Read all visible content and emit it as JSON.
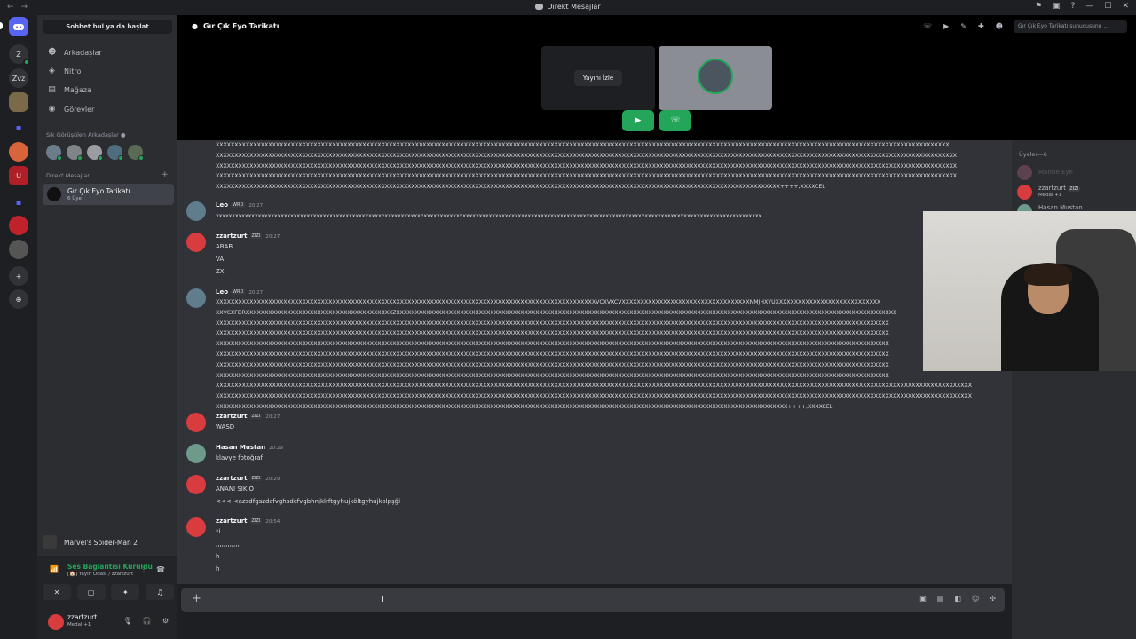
{
  "window": {
    "title": "Direkt Mesajlar",
    "nav_back": "←",
    "nav_forward": "→",
    "right_icons": [
      "⚑",
      "▣",
      "?",
      "—",
      "☐",
      "✕"
    ]
  },
  "guilds": {
    "items": [
      {
        "label": "",
        "icon": "discord-home-icon"
      },
      {
        "label": "Z"
      },
      {
        "label": "Zvz"
      },
      {
        "label": ""
      },
      {
        "label": "▪"
      },
      {
        "label": ""
      },
      {
        "label": "U"
      },
      {
        "label": "▪"
      },
      {
        "label": ""
      },
      {
        "label": ""
      },
      {
        "label": "+"
      },
      {
        "label": "⊕"
      }
    ]
  },
  "sidebar": {
    "find_label": "Sohbet bul ya da başlat",
    "nav": [
      {
        "label": "Arkadaşlar",
        "icon": "friends-icon"
      },
      {
        "label": "Nitro",
        "icon": "nitro-icon"
      },
      {
        "label": "Mağaza",
        "icon": "shop-icon"
      },
      {
        "label": "Görevler",
        "icon": "quests-icon"
      }
    ],
    "frequent_label": "Sık Görüşülen Arkadaşlar",
    "dm_label": "Direkt Mesajlar",
    "dm_add": "+",
    "dm_active": {
      "name": "Gır Çık Eyo Tarikatı",
      "sub": "6 Üye"
    }
  },
  "activity": {
    "game": "Marvel's Spider-Man 2"
  },
  "voice": {
    "status": "Ses Bağlantısı Kuruldu",
    "channel": "[🏠] Yayın Odası / zzartzurt"
  },
  "user": {
    "name": "zzartzurt",
    "sub": "Medal +1"
  },
  "call": {
    "header": "Gır Çık Eyo Tarikatı",
    "watch_label": "Yayını İzle",
    "search_placeholder": "Gır Çık Eyo Tarikatı sunucusunu ..."
  },
  "messages": {
    "block1": "XXXXXXXXXXXXXXXXXXXXXXXXXXXXXXXXXXXXXXXXXXXXXXXXXXXXXXXXXXXXXXXXXXXXXXXXXXXXXXXXXXXXXXXXXXXXXXXXXXXXXXXXXXXXXXXXXXXXXXXXXXXXXXXXXXXXXXXXXXXXXXXXXXXXXXXXXXXXXXXXXXXXXXXXXXXXXXXXXXXXXXXXXXXXXXXXXXX\nXXXXXXXXXXXXXXXXXXXXXXXXXXXXXXXXXXXXXXXXXXXXXXXXXXXXXXXXXXXXXXXXXXXXXXXXXXXXXXXXXXXXXXXXXXXXXXXXXXXXXXXXXXXXXXXXXXXXXXXXXXXXXXXXXXXXXXXXXXXXXXXXXXXXXXXXXXXXXXXXXXXXXXXXXXXXXXXXXXXXXXXXXXXXXXXXXXXXX\nXXXXXXXXXXXXXXXXXXXXXXXXXXXXXXXXXXXXXXXXXXXXXXXXXXXXXXXXXXXXXXXXXXXXXXXXXXXXXXXXXXXXXXXXXXXXXXXXXXXXXXXXXXXXXXXXXXXXXXXXXXXXXXXXXXXXXXXXXXXXXXXXXXXXXXXXXXXXXXXXXXXXXXXXXXXXXXXXXXXXXXXXXXXXXXXXXXXXX\nXXXXXXXXXXXXXXXXXXXXXXXXXXXXXXXXXXXXXXXXXXXXXXXXXXXXXXXXXXXXXXXXXXXXXXXXXXXXXXXXXXXXXXXXXXXXXXXXXXXXXXXXXXXXXXXXXXXXXXXXXXXXXXXXXXXXXXXXXXXXXXXXXXXXXXXXXXXXXXXXXXXXXXXXXXXXXXXXXXXXXXXXXXXXXXXXXXXXX\nXXXXXXXXXXXXXXXXXXXXXXXXXXXXXXXXXXXXXXXXXXXXXXXXXXXXXXXXXXXXXXXXXXXXXXXXXXXXXXXXXXXXXXXXXXXXXXXXXXXXXXXXXXXXXXXXXXXXXXXXXXXXXXXXXXXXXXXXXXXXXXXXXXXXXX++++,XXXXCEL",
    "leo1": {
      "name": "Leo",
      "tag": "WRD",
      "time": "20:27",
      "text": "xxxxxxxxxxxxxxxxxxxxxxxxxxxxxxxxxxxxxxxxxxxxxxxxxxxxxxxxxxxxxxxxxxxxxxxxxxxxxxxxxxxxxxxxxxxxxxxxxxxxxxxxxxxxxxxxxxxxxxxxxxxxxxxxxxxxxxxxxxxxxxxxxxxxxxxxxxxxxxxxxxxxxxxx"
    },
    "zz1": {
      "name": "zzartzurt",
      "tag": "ZIZI",
      "time": "20:27",
      "lines": [
        "ABAB",
        "VA",
        "ZX"
      ]
    },
    "leo2": {
      "name": "Leo",
      "tag": "WRD",
      "time": "20:27",
      "text": "XXXXXXXXXXXXXXXXXXXXXXXXXXXXXXXXXXXXXXXXXXXXXXXXXXXXXXXXXXXXXXXXXXXXXXXXXXXXXXXXXXXXXXXXXXXXXXXXXXXXXVCXVXCVXXXXXXXXXXXXXXXXXXXXXXXXXXXXXXXXXXNMJHXYUXXXXXXXXXXXXXXXXXXXXXXXXXXXX\nXXVCXFDRXXXXXXXXXXXXXXXXXXXXXXXXXXXXXXXXXXXXXXXZXXXXXXXXXXXXXXXXXXXXXXXXXXXXXXXXXXXXXXXXXXXXXXXXXXXXXXXXXXXXXXXXXXXXXXXXXXXXXXXXXXXXXXXXXXXXXXXXXXXXXXXXXXXXXXXXXXXXXXXXXXXXXXXXXXXXX\nXXXXXXXXXXXXXXXXXXXXXXXXXXXXXXXXXXXXXXXXXXXXXXXXXXXXXXXXXXXXXXXXXXXXXXXXXXXXXXXXXXXXXXXXXXXXXXXXXXXXXXXXXXXXXXXXXXXXXXXXXXXXXXXXXXXXXXXXXXXXXXXXXXXXXXXXXXXXXXXXXXXXXXXXXXXXXXXXXXX\nXXXXXXXXXXXXXXXXXXXXXXXXXXXXXXXXXXXXXXXXXXXXXXXXXXXXXXXXXXXXXXXXXXXXXXXXXXXXXXXXXXXXXXXXXXXXXXXXXXXXXXXXXXXXXXXXXXXXXXXXXXXXXXXXXXXXXXXXXXXXXXXXXXXXXXXXXXXXXXXXXXXXXXXXXXXXXXXXXXX\nXXXXXXXXXXXXXXXXXXXXXXXXXXXXXXXXXXXXXXXXXXXXXXXXXXXXXXXXXXXXXXXXXXXXXXXXXXXXXXXXXXXXXXXXXXXXXXXXXXXXXXXXXXXXXXXXXXXXXXXXXXXXXXXXXXXXXXXXXXXXXXXXXXXXXXXXXXXXXXXXXXXXXXXXXXXXXXXXXXX\nXXXXXXXXXXXXXXXXXXXXXXXXXXXXXXXXXXXXXXXXXXXXXXXXXXXXXXXXXXXXXXXXXXXXXXXXXXXXXXXXXXXXXXXXXXXXXXXXXXXXXXXXXXXXXXXXXXXXXXXXXXXXXXXXXXXXXXXXXXXXXXXXXXXXXXXXXXXXXXXXXXXXXXXXXXXXXXXXXXX\nXXXXXXXXXXXXXXXXXXXXXXXXXXXXXXXXXXXXXXXXXXXXXXXXXXXXXXXXXXXXXXXXXXXXXXXXXXXXXXXXXXXXXXXXXXXXXXXXXXXXXXXXXXXXXXXXXXXXXXXXXXXXXXXXXXXXXXXXXXXXXXXXXXXXXXXXXXXXXXXXXXXXXXXXXXXXXXXXXXX\nXXXXXXXXXXXXXXXXXXXXXXXXXXXXXXXXXXXXXXXXXXXXXXXXXXXXXXXXXXXXXXXXXXXXXXXXXXXXXXXXXXXXXXXXXXXXXXXXXXXXXXXXXXXXXXXXXXXXXXXXXXXXXXXXXXXXXXXXXXXXXXXXXXXXXXXXXXXXXXXXXXXXXXXXXXXXXXXXXXX\nXXXXXXXXXXXXXXXXXXXXXXXXXXXXXXXXXXXXXXXXXXXXXXXXXXXXXXXXXXXXXXXXXXXXXXXXXXXXXXXXXXXXXXXXXXXXXXXXXXXXXXXXXXXXXXXXXXXXXXXXXXXXXXXXXXXXXXXXXXXXXXXXXXXXXXXXXXXXXXXXXXXXXXXXXXXXXXXXXXXXXXXXXXXXXXXXXXXXXXXXX\nXXXXXXXXXXXXXXXXXXXXXXXXXXXXXXXXXXXXXXXXXXXXXXXXXXXXXXXXXXXXXXXXXXXXXXXXXXXXXXXXXXXXXXXXXXXXXXXXXXXXXXXXXXXXXXXXXXXXXXXXXXXXXXXXXXXXXXXXXXXXXXXXXXXXXXXXXXXXXXXXXXXXXXXXXXXXXXXXXXXXXXXXXXXXXXXXXXXXXXXXX\nXXXXXXXXXXXXXXXXXXXXXXXXXXXXXXXXXXXXXXXXXXXXXXXXXXXXXXXXXXXXXXXXXXXXXXXXXXXXXXXXXXXXXXXXXXXXXXXXXXXXXXXXXXXXXXXXXXXXXXXXXXXXXXXXXXXXXXXXXXXXXXXXXXXXXXXX++++,XXXXCEL"
    },
    "zz2": {
      "name": "zzartzurt",
      "tag": "ZIZI",
      "time": "20:27",
      "text": "WASD"
    },
    "has1": {
      "name": "Hasan Mustan",
      "time": "20:29",
      "text": "klavye fotoğraf"
    },
    "zz3": {
      "name": "zzartzurt",
      "tag": "ZIZI",
      "time": "20:29",
      "lines": [
        "ANANI SIKIÖ",
        "<<< <azsdfgszdcfvghsdcfvgbhnjklrftgyhujköltgyhujkolpşği"
      ]
    },
    "zz4": {
      "name": "zzartzurt",
      "tag": "ZIZI",
      "time": "20:54",
      "lines": [
        "*i",
        ",,,,,,,,,,,,",
        "h",
        "h"
      ]
    }
  },
  "members": {
    "header": "Üyeler—6",
    "items": [
      {
        "name": "Mantle Eye",
        "sub": ""
      },
      {
        "name": "zzartzurt",
        "tag": "ZIZI",
        "sub": "Medal +1"
      },
      {
        "name": "Hasan Mustan",
        "sub": ""
      }
    ]
  },
  "colors": {
    "accent": "#5865f2",
    "green": "#23a55a",
    "red": "#d83c3e"
  }
}
